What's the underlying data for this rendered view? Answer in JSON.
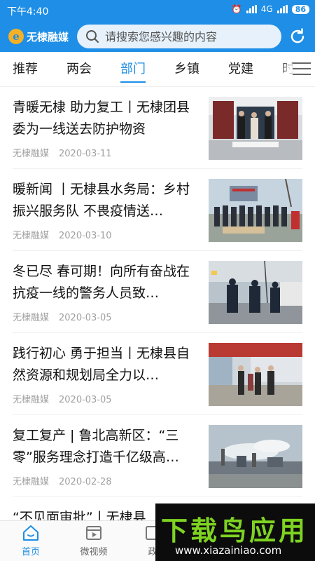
{
  "status_bar": {
    "time": "下午4:40",
    "network": "4G",
    "battery": "86"
  },
  "header": {
    "app_name": "无棣融媒",
    "search_placeholder": "请搜索您感兴趣的内容"
  },
  "tabs": [
    {
      "label": "推荐",
      "active": false
    },
    {
      "label": "两会",
      "active": false
    },
    {
      "label": "部门",
      "active": true
    },
    {
      "label": "乡镇",
      "active": false
    },
    {
      "label": "党建",
      "active": false
    },
    {
      "label": "时",
      "active": false
    }
  ],
  "articles": [
    {
      "title": "青暖无棣 助力复工丨无棣团县委为一线送去防护物资",
      "source": "无棣融媒",
      "date": "2020-03-11"
    },
    {
      "title": "暖新闻 丨无棣县水务局：乡村振兴服务队 不畏疫情送…",
      "source": "无棣融媒",
      "date": "2020-03-10"
    },
    {
      "title": "冬已尽 春可期！向所有奋战在抗疫一线的警务人员致…",
      "source": "无棣融媒",
      "date": "2020-03-05"
    },
    {
      "title": "践行初心 勇于担当丨无棣县自然资源和规划局全力以…",
      "source": "无棣融媒",
      "date": "2020-03-05"
    },
    {
      "title": "复工复产 | 鲁北高新区：“三零”服务理念打造千亿级高…",
      "source": "无棣融媒",
      "date": "2020-02-28"
    },
    {
      "title": "“不见面审批”丨无棣县",
      "source": "",
      "date": ""
    }
  ],
  "bottom_nav": [
    {
      "label": "首页",
      "icon": "home-icon",
      "active": true
    },
    {
      "label": "微视频",
      "icon": "video-icon",
      "active": false
    },
    {
      "label": "政",
      "icon": "gov-icon",
      "active": false
    }
  ],
  "watermark": {
    "text": "下载鸟应用",
    "url": "www.xiazainiao.com"
  },
  "colors": {
    "brand": "#1e8ee6",
    "watermark_green": "#7ed321"
  }
}
